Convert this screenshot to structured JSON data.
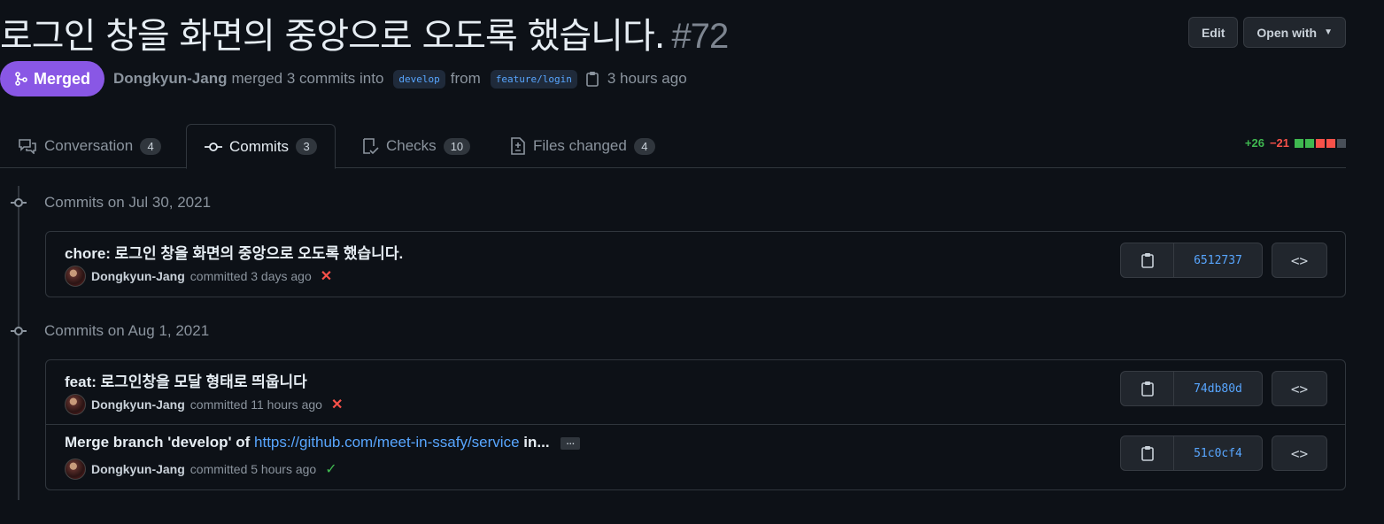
{
  "pr": {
    "title": "로그인 창을 화면의 중앙으로 오도록 했습니다.",
    "number": "#72",
    "status": "Merged",
    "author": "Dongkyun-Jang",
    "merge_text": "merged 3 commits into",
    "base_branch": "develop",
    "from_text": "from",
    "head_branch": "feature/login",
    "time": "3 hours ago"
  },
  "header_actions": {
    "edit": "Edit",
    "open_with": "Open with"
  },
  "tabs": [
    {
      "label": "Conversation",
      "count": "4",
      "icon": "comment-discussion-icon"
    },
    {
      "label": "Commits",
      "count": "3",
      "icon": "git-commit-icon"
    },
    {
      "label": "Checks",
      "count": "10",
      "icon": "checklist-icon"
    },
    {
      "label": "Files changed",
      "count": "4",
      "icon": "file-diff-icon"
    }
  ],
  "diffstat": {
    "additions": "+26",
    "deletions": "−21"
  },
  "colors": {
    "merged": "#8957e5",
    "add": "#3fb950",
    "del": "#f85149",
    "link": "#58a6ff"
  },
  "commit_groups": [
    {
      "date_label": "Commits on Jul 30, 2021",
      "commits": [
        {
          "title": "chore: 로그인 창을 화면의 중앙으로 오도록 했습니다.",
          "author": "Dongkyun-Jang",
          "when": "committed 3 days ago",
          "status": "failure",
          "sha": "6512737"
        }
      ]
    },
    {
      "date_label": "Commits on Aug 1, 2021",
      "commits": [
        {
          "title": "feat: 로그인창을 모달 형태로 띄웁니다",
          "author": "Dongkyun-Jang",
          "when": "committed 11 hours ago",
          "status": "failure",
          "sha": "74db80d"
        },
        {
          "title_prefix": "Merge branch 'develop' of",
          "title_link": "https://github.com/meet-in-ssafy/service",
          "title_suffix": "in...",
          "ellipsis": "…",
          "author": "Dongkyun-Jang",
          "when": "committed 5 hours ago",
          "status": "success",
          "sha": "51c0cf4"
        }
      ]
    }
  ]
}
